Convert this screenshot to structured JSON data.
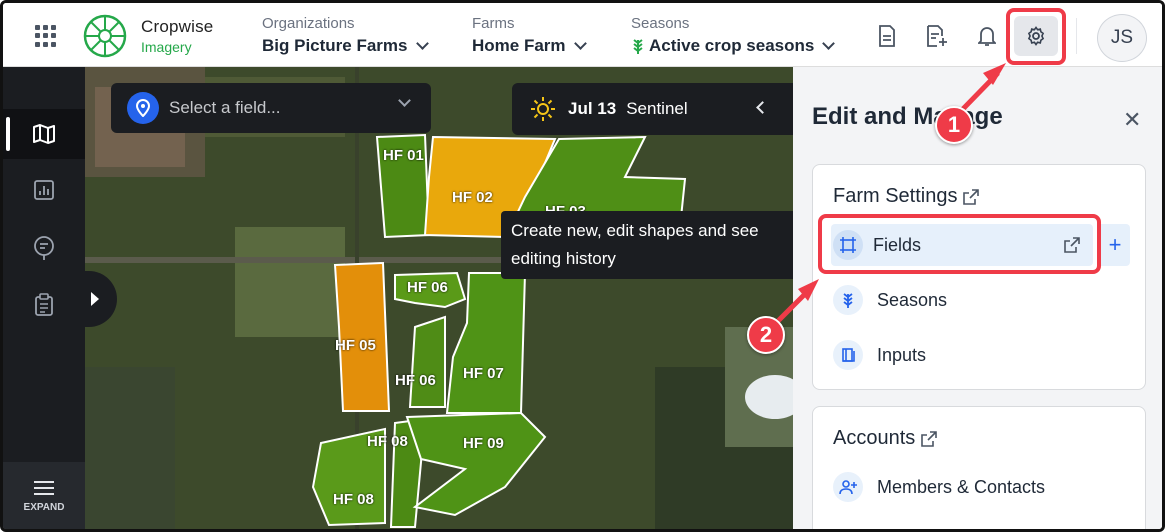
{
  "app": {
    "brand_line1": "Cropwise",
    "brand_line2": "Imagery",
    "brand_color": "#25a84a"
  },
  "header": {
    "organizations": {
      "label": "Organizations",
      "value": "Big Picture Farms"
    },
    "farms": {
      "label": "Farms",
      "value": "Home Farm"
    },
    "seasons": {
      "label": "Seasons",
      "value": "Active crop seasons"
    },
    "icons": [
      "report-icon",
      "add-report-icon",
      "bell-icon",
      "gear-icon"
    ],
    "avatar_initials": "JS"
  },
  "rail": {
    "items": [
      "map-icon",
      "chart-icon",
      "chat-icon",
      "clipboard-icon"
    ],
    "expand_label": "EXPAND"
  },
  "map": {
    "field_select_placeholder": "Select a field...",
    "date": "Jul 13",
    "source": "Sentinel",
    "fields": [
      "HF 01",
      "HF 02",
      "HF 03",
      "HF 05",
      "HF 06",
      "HF 06",
      "HF 07",
      "HF 08",
      "HF 08",
      "HF 09"
    ]
  },
  "tooltip": "Create new, edit shapes and see editing history",
  "panel": {
    "title": "Edit and Manage",
    "farm_settings": {
      "heading": "Farm Settings",
      "items": [
        "Fields",
        "Seasons",
        "Inputs"
      ]
    },
    "accounts": {
      "heading": "Accounts",
      "items": [
        "Members & Contacts"
      ]
    }
  },
  "annotations": {
    "step1": "1",
    "step2": "2",
    "highlight_color": "#ef3b48"
  }
}
